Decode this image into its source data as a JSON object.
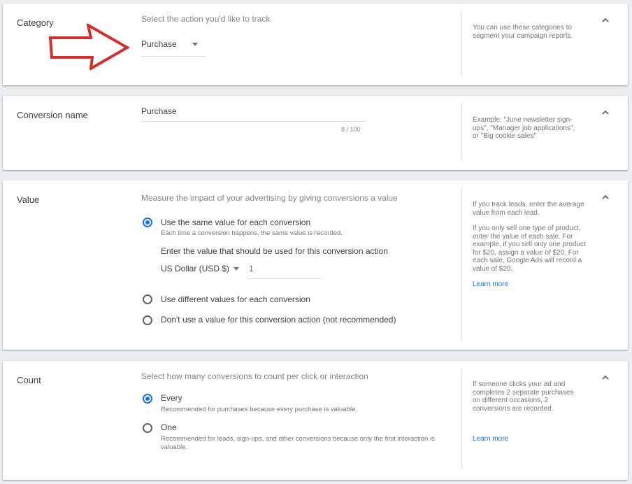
{
  "colors": {
    "accent": "#1a73e8",
    "arrow": "#d32f2f",
    "text": "#3c4043",
    "muted": "#80868b"
  },
  "category": {
    "title": "Category",
    "hint": "Select the action you'd like to track",
    "selected": "Purchase",
    "help": "You can use these categories to segment your campaign reports."
  },
  "conversion_name": {
    "title": "Conversion name",
    "value": "Purchase",
    "counter": "8 / 100",
    "help": "Example: \"June newsletter sign-ups\", \"Manager job applications\", or \"Big cookie sales\""
  },
  "value": {
    "title": "Value",
    "hint": "Measure the impact of your advertising by giving conversions a value",
    "option_same": "Use the same value for each conversion",
    "option_same_sub": "Each time a conversion happens, the same value is recorded.",
    "enter_value_label": "Enter the value that should be used for this conversion action",
    "currency": "US Dollar (USD $)",
    "amount": "1",
    "option_different": "Use different values for each conversion",
    "option_none": "Don't use a value for this conversion action (not recommended)",
    "help1": "If you track leads, enter the average value from each lead.",
    "help2": "If you only sell one type of product, enter the value of each sale. For example, if you sell only one product for $20, assign a value of $20. For each sale, Google Ads will record a value of $20.",
    "learn_more": "Learn more"
  },
  "count": {
    "title": "Count",
    "hint": "Select how many conversions to count per click or interaction",
    "option_every": "Every",
    "option_every_sub": "Recommended for purchases because every purchase is valuable.",
    "option_one": "One",
    "option_one_sub": "Recommended for leads, sign-ups, and other conversions because only the first interaction is valuable.",
    "help": "If someone clicks your ad and completes 2 separate purchases on different occasions, 2 conversions are recorded.",
    "learn_more": "Learn more"
  },
  "icons": {
    "collapse": "chevron-up-icon",
    "annotation": "red-arrow-icon",
    "dropdown": "caret-down-icon"
  }
}
